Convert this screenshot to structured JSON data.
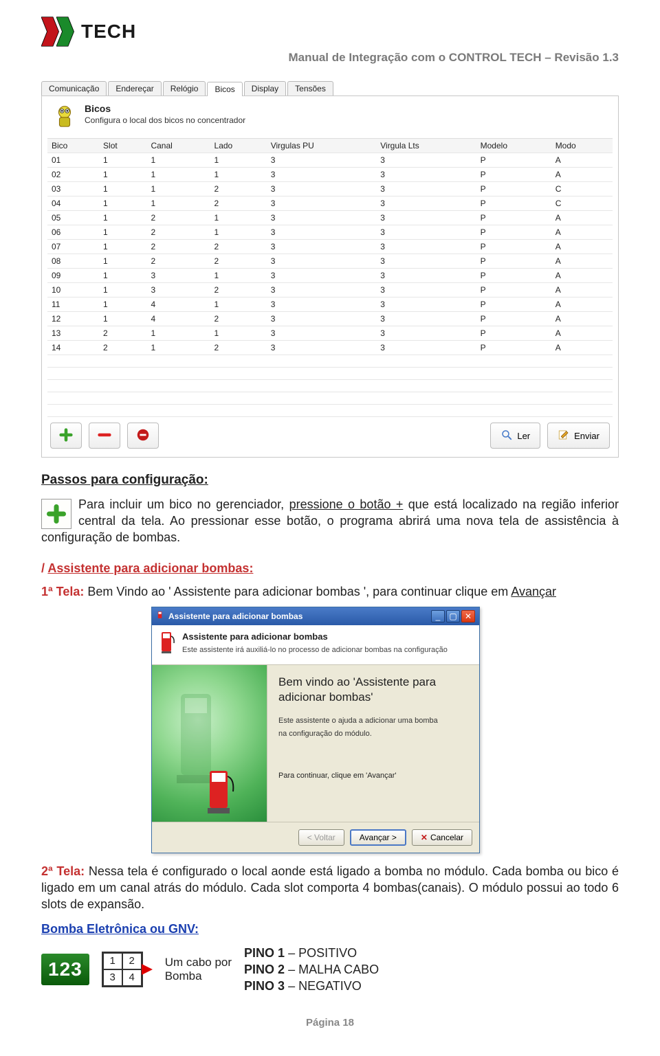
{
  "header": {
    "logo_text": "TECH",
    "doc_title": "Manual de Integração com o CONTROL TECH – Revisão 1.3"
  },
  "tabs": [
    "Comunicação",
    "Endereçar",
    "Relógio",
    "Bicos",
    "Display",
    "Tensões"
  ],
  "active_tab_index": 3,
  "panel": {
    "title": "Bicos",
    "desc": "Configura o local dos bicos no concentrador"
  },
  "table": {
    "columns": [
      "Bico",
      "Slot",
      "Canal",
      "Lado",
      "Virgulas PU",
      "Virgula Lts",
      "Modelo",
      "Modo"
    ],
    "rows": [
      [
        "01",
        "1",
        "1",
        "1",
        "3",
        "3",
        "P",
        "A"
      ],
      [
        "02",
        "1",
        "1",
        "1",
        "3",
        "3",
        "P",
        "A"
      ],
      [
        "03",
        "1",
        "1",
        "2",
        "3",
        "3",
        "P",
        "C"
      ],
      [
        "04",
        "1",
        "1",
        "2",
        "3",
        "3",
        "P",
        "C"
      ],
      [
        "05",
        "1",
        "2",
        "1",
        "3",
        "3",
        "P",
        "A"
      ],
      [
        "06",
        "1",
        "2",
        "1",
        "3",
        "3",
        "P",
        "A"
      ],
      [
        "07",
        "1",
        "2",
        "2",
        "3",
        "3",
        "P",
        "A"
      ],
      [
        "08",
        "1",
        "2",
        "2",
        "3",
        "3",
        "P",
        "A"
      ],
      [
        "09",
        "1",
        "3",
        "1",
        "3",
        "3",
        "P",
        "A"
      ],
      [
        "10",
        "1",
        "3",
        "2",
        "3",
        "3",
        "P",
        "A"
      ],
      [
        "11",
        "1",
        "4",
        "1",
        "3",
        "3",
        "P",
        "A"
      ],
      [
        "12",
        "1",
        "4",
        "2",
        "3",
        "3",
        "P",
        "A"
      ],
      [
        "13",
        "2",
        "1",
        "1",
        "3",
        "3",
        "P",
        "A"
      ],
      [
        "14",
        "2",
        "1",
        "2",
        "3",
        "3",
        "P",
        "A"
      ]
    ]
  },
  "toolbar": {
    "read_label": "Ler",
    "send_label": "Enviar"
  },
  "text": {
    "passos_title": "Passos para configuração:",
    "passos_body_1": "Para incluir um bico no gerenciador, ",
    "passos_body_link": "pressione o botão +",
    "passos_body_2": " que está localizado na região inferior central da tela. Ao pressionar esse botão, o programa abrirá uma nova tela de assistência à configuração de bombas.",
    "assist_title_prefix": "/ ",
    "assist_title": "Assistente para adicionar bombas:",
    "tela1_label": "1ª Tela:",
    "tela1_body": " Bem Vindo ao ' Assistente para adicionar bombas ', para continuar clique em ",
    "tela1_link": "Avançar",
    "tela2_label": "2ª Tela:",
    "tela2_body": " Nessa tela é configurado o local aonde está ligado a bomba no módulo. Cada bomba ou bico é ligado em um canal atrás do módulo. Cada slot comporta 4 bombas(canais). O módulo possui ao todo 6 slots de expansão.",
    "bomba_title": "Bomba Eletrônica ou GNV:"
  },
  "wizard": {
    "titlebar": "Assistente para adicionar bombas",
    "head_title": "Assistente para adicionar bombas",
    "head_desc": "Este assistente irá auxiliá-lo no processo de adicionar bombas na configuração",
    "welcome": "Bem vindo ao 'Assistente para adicionar bombas'",
    "helper_1": "Este assistente o ajuda a adicionar uma bomba",
    "helper_2": "na configuração do módulo.",
    "cont_hint": "Para continuar, clique em 'Avançar'",
    "btn_back": "< Voltar",
    "btn_next": "Avançar >",
    "btn_cancel": "Cancelar"
  },
  "bomba": {
    "badge": "123",
    "grid": [
      "1",
      "2",
      "3",
      "4"
    ],
    "cable_1": "Um cabo por",
    "cable_2": "Bomba",
    "pins": [
      {
        "label": "PINO 1",
        "desc": " – POSITIVO"
      },
      {
        "label": "PINO 2",
        "desc": " – MALHA CABO"
      },
      {
        "label": "PINO 3",
        "desc": " – NEGATIVO"
      }
    ]
  },
  "footer": {
    "page": "Página 18"
  },
  "chart_data": {
    "type": "table",
    "title": "Bicos",
    "columns": [
      "Bico",
      "Slot",
      "Canal",
      "Lado",
      "Virgulas PU",
      "Virgula Lts",
      "Modelo",
      "Modo"
    ],
    "rows": [
      [
        "01",
        "1",
        "1",
        "1",
        "3",
        "3",
        "P",
        "A"
      ],
      [
        "02",
        "1",
        "1",
        "1",
        "3",
        "3",
        "P",
        "A"
      ],
      [
        "03",
        "1",
        "1",
        "2",
        "3",
        "3",
        "P",
        "C"
      ],
      [
        "04",
        "1",
        "1",
        "2",
        "3",
        "3",
        "P",
        "C"
      ],
      [
        "05",
        "1",
        "2",
        "1",
        "3",
        "3",
        "P",
        "A"
      ],
      [
        "06",
        "1",
        "2",
        "1",
        "3",
        "3",
        "P",
        "A"
      ],
      [
        "07",
        "1",
        "2",
        "2",
        "3",
        "3",
        "P",
        "A"
      ],
      [
        "08",
        "1",
        "2",
        "2",
        "3",
        "3",
        "P",
        "A"
      ],
      [
        "09",
        "1",
        "3",
        "1",
        "3",
        "3",
        "P",
        "A"
      ],
      [
        "10",
        "1",
        "3",
        "2",
        "3",
        "3",
        "P",
        "A"
      ],
      [
        "11",
        "1",
        "4",
        "1",
        "3",
        "3",
        "P",
        "A"
      ],
      [
        "12",
        "1",
        "4",
        "2",
        "3",
        "3",
        "P",
        "A"
      ],
      [
        "13",
        "2",
        "1",
        "1",
        "3",
        "3",
        "P",
        "A"
      ],
      [
        "14",
        "2",
        "1",
        "2",
        "3",
        "3",
        "P",
        "A"
      ]
    ]
  }
}
